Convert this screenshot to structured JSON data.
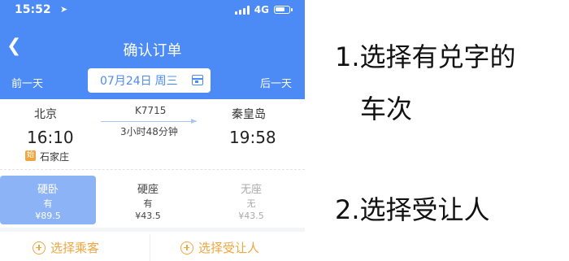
{
  "status_bar": {
    "time": "15:52",
    "network": "4G",
    "icons": [
      "location-arrow-icon",
      "signal-icon",
      "battery-icon"
    ]
  },
  "header": {
    "title": "确认订单",
    "back_icon": "chevron-left-icon"
  },
  "date_bar": {
    "prev": "前一天",
    "next": "后一天",
    "date": "07月24日",
    "weekday": "周三",
    "icon": "calendar-icon"
  },
  "trip": {
    "from": "北京",
    "to": "秦皇岛",
    "depart_time": "16:10",
    "arrive_time": "19:58",
    "train_no": "K7715",
    "duration": "3小时48分钟",
    "via_icon_text": "始",
    "via_station": "石家庄"
  },
  "seats": [
    {
      "name": "硬卧",
      "availability": "有",
      "price": "¥89.5",
      "selected": true
    },
    {
      "name": "硬座",
      "availability": "有",
      "price": "¥43.5",
      "selected": false
    },
    {
      "name": "无座",
      "availability": "无",
      "price": "¥43.5",
      "selected": false
    }
  ],
  "actions": {
    "select_passenger": "选择乘客",
    "select_transferee": "选择受让人"
  },
  "annotations": {
    "step1_line1": "1.选择有兑字的",
    "step1_line2": "车次",
    "step2": "2.选择受让人"
  },
  "colors": {
    "primary": "#4c8bf5",
    "selected_seat": "#8cb3f6",
    "accent": "#f0a640"
  }
}
